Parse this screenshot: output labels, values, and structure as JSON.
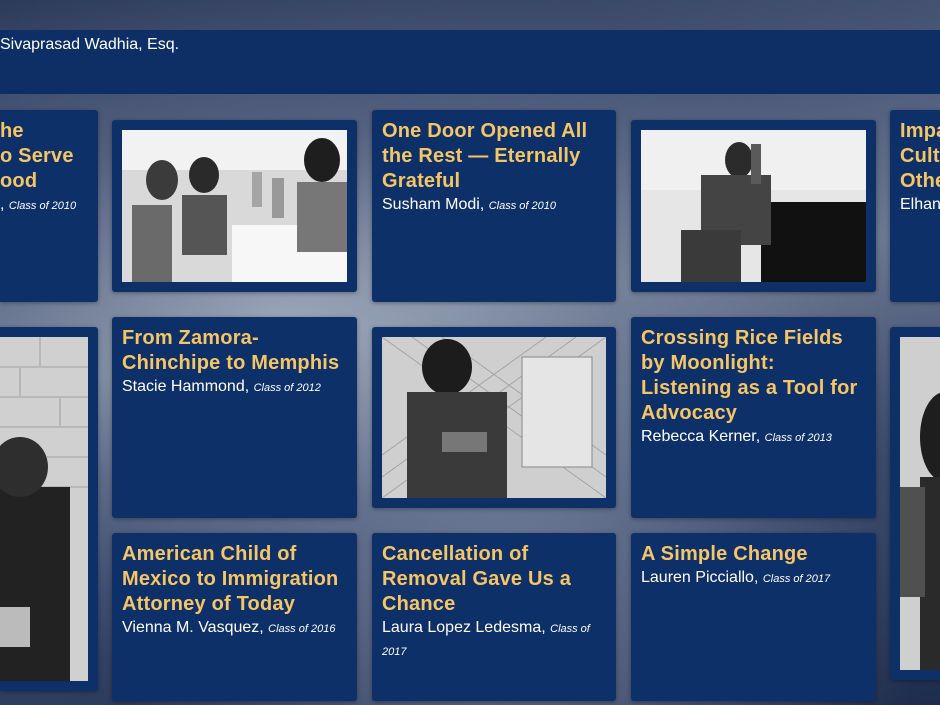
{
  "header": {
    "name": "Sivaprasad Wadhia, Esq."
  },
  "stories": {
    "top_left": {
      "title_lines": [
        "he",
        "o Serve",
        "ood"
      ],
      "author": "",
      "class_label": "Class of 2010"
    },
    "one_door": {
      "title": "One Door Opened All the Rest — Eternally Grateful",
      "author": "Susham Modi",
      "class_label": "Class of 2010"
    },
    "top_right": {
      "title_lines": [
        "Impa",
        "Cult",
        "Othe"
      ],
      "author": "Elhan"
    },
    "zamora": {
      "title": "From Zamora-Chinchipe to Memphis",
      "author": "Stacie Hammond",
      "class_label": "Class of 2012"
    },
    "rice_fields": {
      "title": "Crossing Rice Fields by Moonlight: Listening as a Tool for Advocacy",
      "author": "Rebecca Kerner",
      "class_label": "Class of 2013"
    },
    "american_child": {
      "title": "American Child of Mexico to Immigration Attorney of Today",
      "author": "Vienna M. Vasquez",
      "class_label": "Class of 2016"
    },
    "cancellation": {
      "title": "Cancellation of Removal Gave Us a Chance",
      "author": "Laura Lopez Ledesma",
      "class_label": "Class of 2017"
    },
    "simple_change": {
      "title": "A Simple Change",
      "author": "Lauren Picciallo",
      "class_label": "Class of 2017"
    }
  },
  "photos": {
    "family_visit": "family-visitation-photo",
    "man_seated": "detained-man-photo",
    "woman_fence": "detained-woman-photo",
    "left_portrait": "detainee-portrait-photo",
    "right_portrait": "detainee-portrait-photo"
  }
}
